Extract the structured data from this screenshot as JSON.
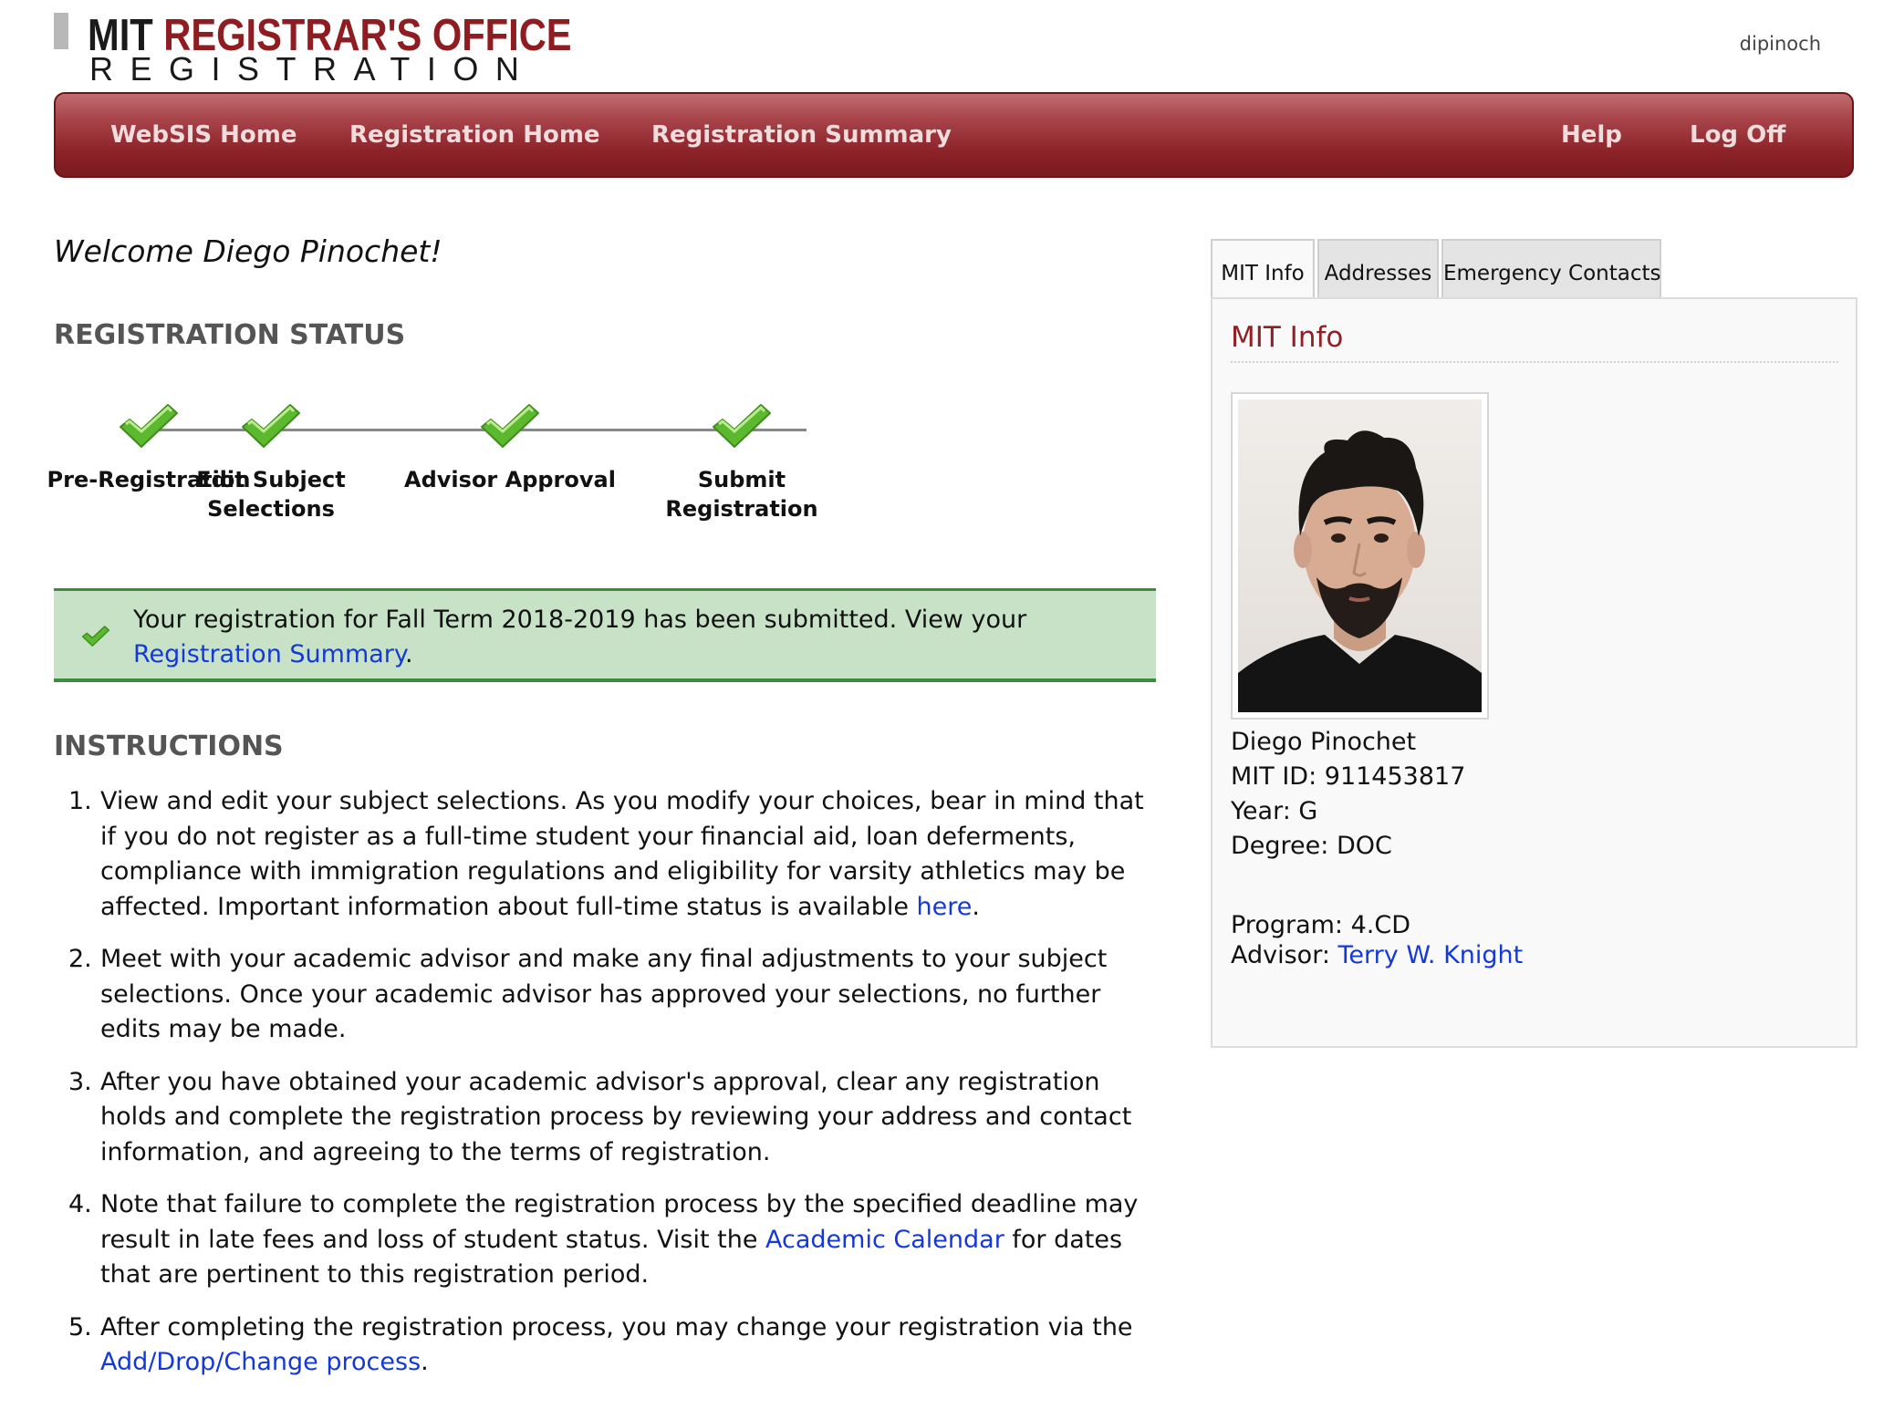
{
  "header": {
    "logo_prefix": "MIT",
    "logo_office": "REGISTRAR'S OFFICE",
    "logo_sub": "REGISTRATION",
    "username": "dipinoch"
  },
  "nav": {
    "items": [
      "WebSIS Home",
      "Registration Home",
      "Registration Summary",
      "Help",
      "Log Off"
    ]
  },
  "welcome": "Welcome Diego Pinochet!",
  "status": {
    "title": "REGISTRATION STATUS",
    "steps": [
      {
        "label": "Pre-Registration",
        "complete": true
      },
      {
        "label": "Edit Subject Selections",
        "complete": true
      },
      {
        "label": "Advisor Approval",
        "complete": true
      },
      {
        "label": "Submit Registration",
        "complete": true
      }
    ]
  },
  "alert": {
    "text": "Your registration for Fall Term 2018-2019 has been submitted. View your ",
    "link": "Registration Summary",
    "suffix": "."
  },
  "instructions": {
    "title": "INSTRUCTIONS",
    "items": [
      {
        "num": "1.",
        "text": "View and edit your subject selections. As you modify your choices, bear in mind that if you do not register as a full-time student your financial aid, loan deferments, compliance with immigration regulations and eligibility for varsity athletics may be affected. Important information about full-time status is available ",
        "link": "here",
        "after": "."
      },
      {
        "num": "2.",
        "text": "Meet with your academic advisor and make any final adjustments to your subject selections. Once your academic advisor has approved your selections, no further edits may be made.",
        "link": "",
        "after": ""
      },
      {
        "num": "3.",
        "text": "After you have obtained your academic advisor's approval, clear any registration holds and complete the registration process by reviewing your address and contact information, and agreeing to the terms of registration.",
        "link": "",
        "after": ""
      },
      {
        "num": "4.",
        "text": "Note that failure to complete the registration process by the specified deadline may result in late fees and loss of student status. Visit the ",
        "link": "Academic Calendar",
        "after": " for dates that are pertinent to this registration period."
      },
      {
        "num": "5.",
        "text": "After completing the registration process, you may change your registration via the ",
        "link": "Add/Drop/Change process",
        "after": "."
      }
    ]
  },
  "panel": {
    "tabs": [
      "MIT Info",
      "Addresses",
      "Emergency Contacts"
    ],
    "active_tab": "MIT Info",
    "title": "MIT Info",
    "name": "Diego Pinochet",
    "mit_id": "MIT ID: 911453817",
    "year": "Year: G",
    "degree": "Degree: DOC",
    "program": "Program: 4.CD",
    "advisor_label": "Advisor: ",
    "advisor_name": "Terry W. Knight"
  },
  "colors": {
    "brand": "#8f1c21",
    "link": "#1539d6",
    "success_bg": "#c7e2c7",
    "success_border": "#3d8b3d",
    "check": "#5cb82e"
  }
}
